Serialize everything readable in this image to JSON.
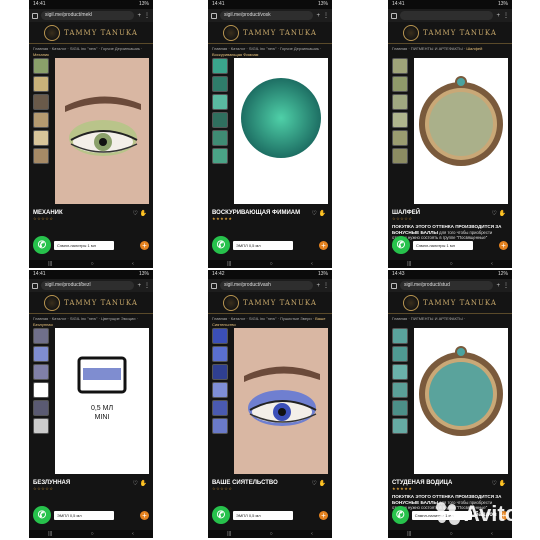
{
  "brand": {
    "name": "TAMMY TANUKA",
    "watermark": "Avito"
  },
  "phones": [
    {
      "time": "14:41",
      "battery": "13%",
      "url": "sigil.me/product/mekl",
      "crumb_path": "Главная · Каталог · SIGIL inc \"new\" · Горчие Дерзинкашиь ·",
      "crumb_current": "Механик",
      "name": "МЕХАНИК",
      "stars": "☆☆☆☆☆",
      "select": "Сэмпл-палитры 1 мл",
      "image": "eye-green"
    },
    {
      "time": "14:41",
      "battery": "13%",
      "url": "sigil.me/product/vosk",
      "crumb_path": "Главная · Каталог · SIGIL inc \"new\" · Горчие Дерзинкашиь ·",
      "crumb_current": "Воскуривающая Фимиам",
      "name": "ВОСКУРИВАЮЩАЯ ФИМИАМ",
      "stars": "★★★★★",
      "select": "ЭМПЛ 0,5 мл",
      "image": "circle-teal"
    },
    {
      "time": "14:41",
      "battery": "13%",
      "url": "",
      "crumb_path": "Главная · ПИГМЕНТЫ И АРТЕФАКТЫ ·",
      "crumb_current": "Шалфей",
      "name": "ШАЛФЕЙ",
      "stars": "☆☆☆☆☆",
      "note_title": "ПОКУПКА ЭТОГО ОТТЕНКА ПРОИЗВОДИТСЯ ЗА БОНУСНЫЕ БАЛЛЫ",
      "note_body": "для того чтобы приобрести оттенок нужно состоять в группе \"Посвященные\"",
      "size_label": "Размер",
      "select": "Сэмпл-палитры 1 мл",
      "image": "compact-gold"
    },
    {
      "time": "14:41",
      "battery": "13%",
      "url": "sigil.me/product/bezl",
      "crumb_path": "Главная · Каталог · SIGIL inc \"new\" · Цветущие Эмоции ·",
      "crumb_current": "Безлунная",
      "name": "БЕЗЛУННАЯ",
      "stars": "☆☆☆☆☆",
      "select": "ЭМПЛ 0,5 мл",
      "image": "jar",
      "jar_text": "0,5 МЛ MINI"
    },
    {
      "time": "14:42",
      "battery": "13%",
      "url": "sigil.me/product/vash",
      "crumb_path": "Главная · Каталог · SIGIL inc \"new\" · Пушистые Звери ·",
      "crumb_current": "Ваше Сиятельство",
      "name": "ВАШЕ СИЯТЕЛЬСТВО",
      "stars": "☆☆☆☆☆",
      "select": "ЭМПЛ 0,5 мл",
      "image": "eye-blue"
    },
    {
      "time": "14:43",
      "battery": "12%",
      "url": "sigil.me/product/stud",
      "crumb_path": "Главная · ПИГМЕНТЫ И АРТЕФАКТЫ ·",
      "crumb_current": "",
      "name": "СТУДЕНАЯ ВОДИЦА",
      "stars": "★★★★★",
      "note_title": "ПОКУПКА ЭТОГО ОТТЕНКА ПРОИЗВОДИТСЯ ЗА БОНУСНЫЕ БАЛЛЫ",
      "note_body": "для того чтобы приобрести оттенок нужно состоять в группе \"Посвященные\"",
      "size_label": "Размер",
      "select": "Сэмпл-палитры 1 мл",
      "bottom_text": "баллов",
      "image": "compact-teal"
    }
  ]
}
